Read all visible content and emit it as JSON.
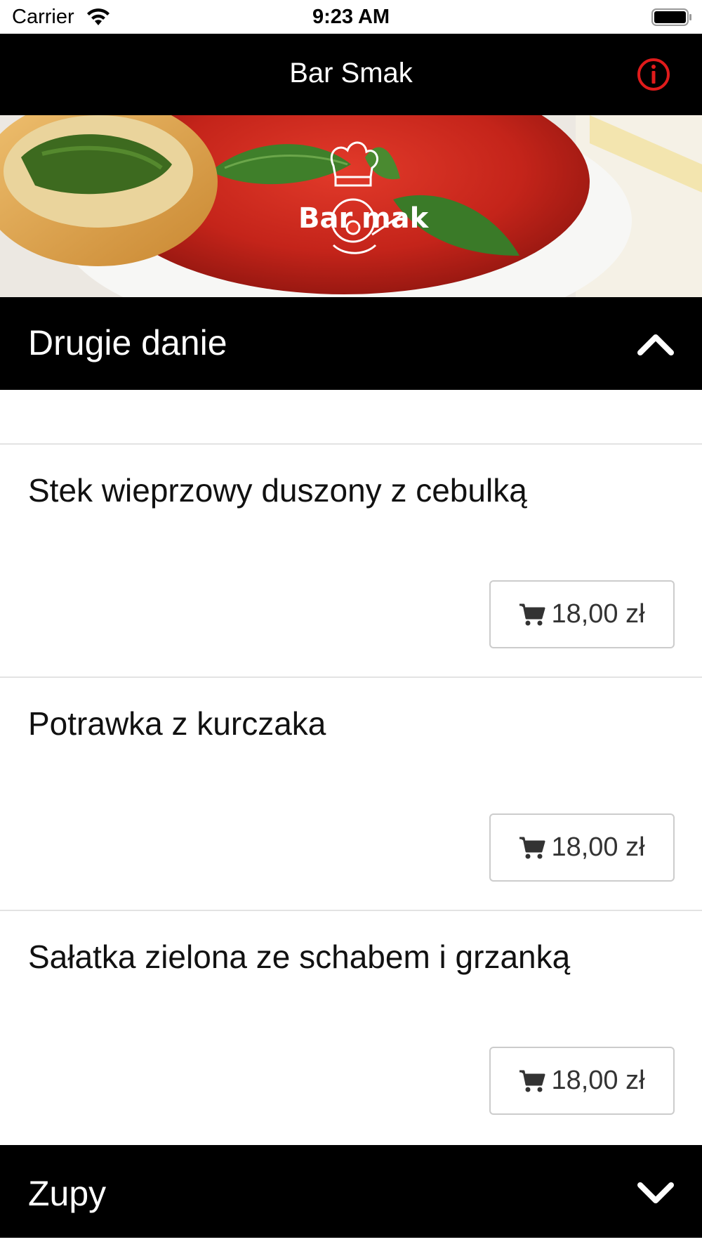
{
  "status_bar": {
    "carrier": "Carrier",
    "time": "9:23 AM"
  },
  "nav": {
    "title": "Bar Smak",
    "info_icon": "info-circle-icon",
    "info_color": "#e01b1b"
  },
  "hero": {
    "logo_text": "Bar Smak"
  },
  "sections": [
    {
      "title": "Drugie danie",
      "expanded": true,
      "items": [
        {
          "name": "Stek wieprzowy duszony z cebulką",
          "price": "18,00 zł"
        },
        {
          "name": "Potrawka z kurczaka",
          "price": "18,00 zł"
        },
        {
          "name": "Sałatka zielona ze schabem i grzanką",
          "price": "18,00 zł"
        }
      ]
    },
    {
      "title": "Zupy",
      "expanded": false,
      "items": []
    }
  ]
}
